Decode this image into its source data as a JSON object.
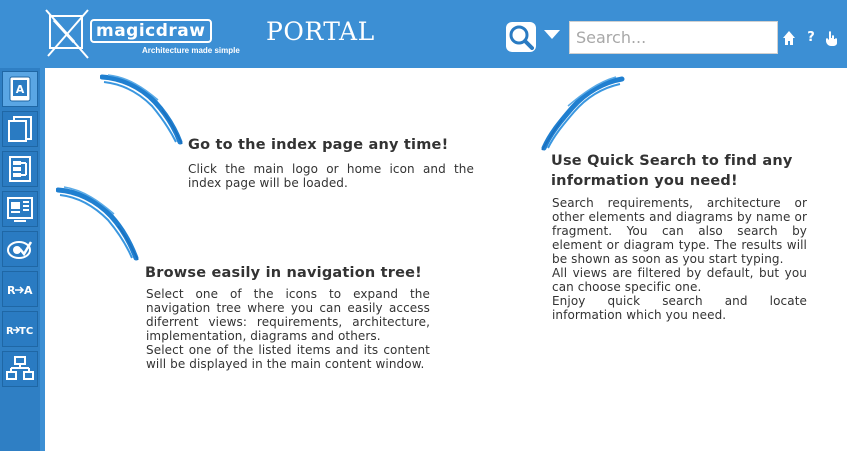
{
  "header": {
    "logo_text": "magicdraw",
    "logo_tagline": "Architecture made simple",
    "portal_title": "PORTAL",
    "search": {
      "placeholder": "Search..."
    },
    "help_label": "?",
    "icons": [
      "search-icon",
      "chevron-down-icon",
      "home-icon",
      "help-icon",
      "settings-icon"
    ]
  },
  "sidebar": {
    "items": [
      {
        "name": "index-view",
        "icon": "index-icon",
        "active": true
      },
      {
        "name": "requirements-view",
        "icon": "document-icon"
      },
      {
        "name": "architecture-view",
        "icon": "architecture-icon"
      },
      {
        "name": "implementation-view",
        "icon": "implementation-icon"
      },
      {
        "name": "others-view",
        "icon": "eye-check-icon"
      },
      {
        "name": "req-architecture-view",
        "icon": "r-arrow-a-icon"
      },
      {
        "name": "req-testcase-view",
        "icon": "r-arrow-tc-icon"
      },
      {
        "name": "hierarchy-view",
        "icon": "hierarchy-icon"
      }
    ]
  },
  "hints": {
    "index": {
      "title": "Go to the index page any time!",
      "body": "Click the main logo or home icon and the index page will be loaded."
    },
    "nav": {
      "title": "Browse easily in navigation tree!",
      "body1": "Select one of the icons to expand the navigation tree where you can easily access diferrent views: requirements, architecture, implementation, diagrams and others.",
      "body2": "Select one of the listed items and its content will be displayed in the main content window."
    },
    "search": {
      "title": "Use Quick Search to find any information you need!",
      "body1": "Search requirements, architecture or other elements and diagrams by name or fragment. You can also search by element or diagram type. The results will be shown as soon as you start typing.",
      "body2": "All views are filtered by default, but you can choose specific one.",
      "body3": "Enjoy quick search and locate information which you need."
    }
  },
  "colors": {
    "header_blue": "#3c8fd4",
    "sidebar_blue": "#2f7fc4",
    "arrow_blue": "#1f7fd0",
    "text": "#333333"
  }
}
